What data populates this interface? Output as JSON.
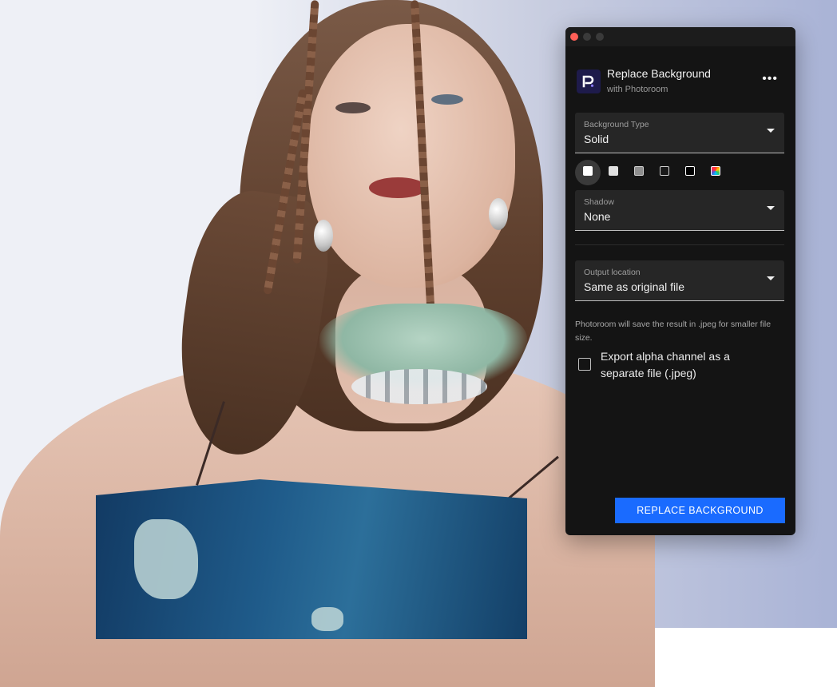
{
  "window": {
    "controls": [
      "close",
      "minimize",
      "maximize"
    ]
  },
  "header": {
    "title": "Replace Background",
    "subtitle": "with Photoroom",
    "logo_icon": "photoroom-logo-icon",
    "more_icon": "more-horizontal-icon",
    "more_label": "•••"
  },
  "background_type": {
    "label": "Background Type",
    "value": "Solid"
  },
  "swatches": [
    {
      "name": "white",
      "color": "#ffffff",
      "selected": true
    },
    {
      "name": "light-gray",
      "color": "#e0e0e0",
      "selected": false
    },
    {
      "name": "gray",
      "color": "#8e8e8e",
      "selected": false
    },
    {
      "name": "dark",
      "color": "#1a1a1a",
      "selected": false
    },
    {
      "name": "black",
      "color": "#000000",
      "selected": false
    },
    {
      "name": "custom-color",
      "color": "multicolor",
      "selected": false
    }
  ],
  "shadow": {
    "label": "Shadow",
    "value": "None"
  },
  "output_location": {
    "label": "Output location",
    "value": "Same as original file"
  },
  "note": "Photoroom will save the result in .jpeg for smaller file size.",
  "export_alpha": {
    "label": "Export alpha channel as a separate file (.jpeg)",
    "checked": false
  },
  "primary_button": {
    "label": "REPLACE BACKGROUND",
    "color": "#1a6bff"
  }
}
